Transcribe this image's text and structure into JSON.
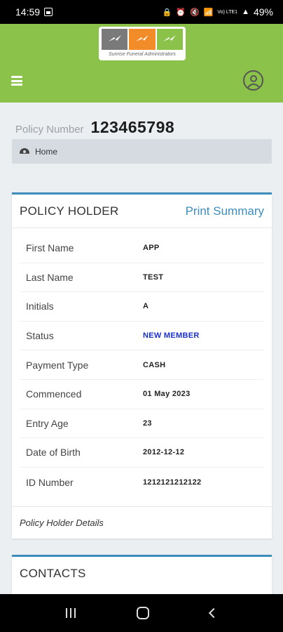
{
  "status_bar": {
    "time": "14:59",
    "battery": "49%",
    "network": "Vo) LTE1"
  },
  "app_bar": {
    "logo_text": "Sunrise Funeral Administrators"
  },
  "policy": {
    "label": "Policy Number",
    "number": "123465798"
  },
  "breadcrumb": {
    "home_label": "Home"
  },
  "policy_holder": {
    "title": "POLICY HOLDER",
    "print_link": "Print Summary",
    "rows": [
      {
        "label": "First Name",
        "value": "APP"
      },
      {
        "label": "Last Name",
        "value": "TEST"
      },
      {
        "label": "Initials",
        "value": "A"
      },
      {
        "label": "Status",
        "value": "NEW MEMBER"
      },
      {
        "label": "Payment Type",
        "value": "CASH"
      },
      {
        "label": "Commenced",
        "value": "01 May 2023"
      },
      {
        "label": "Entry Age",
        "value": "23"
      },
      {
        "label": "Date of Birth",
        "value": "2012-12-12"
      },
      {
        "label": "ID Number",
        "value": "1212121212122"
      }
    ],
    "footer": "Policy Holder Details"
  },
  "contacts": {
    "title": "CONTACTS"
  },
  "colors": {
    "app_bar": "#8bc34a",
    "card_accent": "#3c8dbc",
    "status_value": "#1a2fd0",
    "logo_orange": "#f28c28"
  }
}
